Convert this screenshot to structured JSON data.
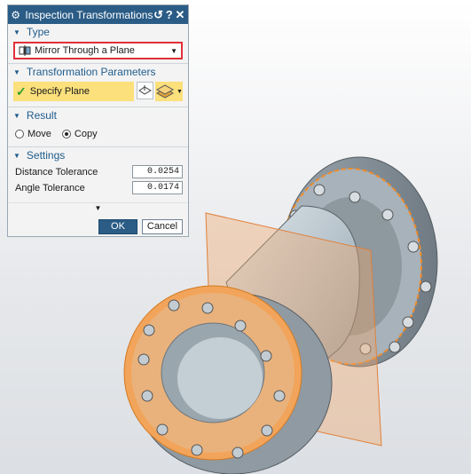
{
  "dialog": {
    "title": "Inspection Transformations",
    "icons": [
      "gear-icon",
      "reset-icon",
      "help-icon",
      "close-icon"
    ],
    "help_label": "?",
    "close_label": "✕",
    "reset_label": "↺"
  },
  "sections": {
    "type": {
      "header": "Type",
      "selected": "Mirror Through a Plane"
    },
    "params": {
      "header": "Transformation Parameters",
      "specify_plane": "Specify Plane"
    },
    "result": {
      "header": "Result",
      "options": [
        "Move",
        "Copy"
      ],
      "selected": "Copy"
    },
    "settings": {
      "header": "Settings",
      "distance_label": "Distance Tolerance",
      "distance_value": "0.0254",
      "angle_label": "Angle Tolerance",
      "angle_value": "0.0174"
    }
  },
  "buttons": {
    "ok": "OK",
    "cancel": "Cancel"
  },
  "colors": {
    "accent": "#2a5c86",
    "highlight": "#fbe07c",
    "selection_border": "#e0303a",
    "model": "#b8c4cc",
    "edge_highlight": "#f08c2a"
  }
}
